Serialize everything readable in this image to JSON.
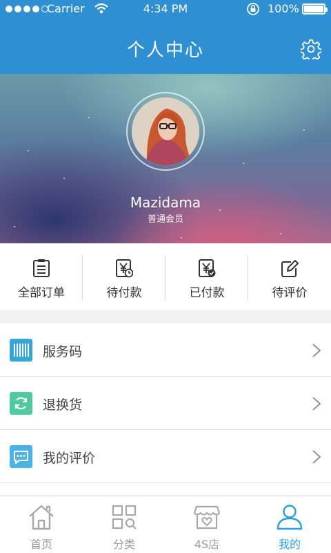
{
  "status_bar": {
    "carrier": "Carrier",
    "time": "4:34 PM",
    "battery": "100%"
  },
  "header": {
    "title": "个人中心",
    "settings_icon": "gear-icon"
  },
  "profile": {
    "username": "Mazidama",
    "member_level": "普通会员"
  },
  "orders": [
    {
      "label": "全部订单",
      "icon": "clipboard-icon"
    },
    {
      "label": "待付款",
      "icon": "yen-clock-icon"
    },
    {
      "label": "已付款",
      "icon": "yen-check-icon"
    },
    {
      "label": "待评价",
      "icon": "edit-icon"
    }
  ],
  "menu": [
    {
      "label": "服务码",
      "icon": "barcode-icon",
      "color": "#35a7d6"
    },
    {
      "label": "退换货",
      "icon": "exchange-icon",
      "color": "#4fcaa0"
    },
    {
      "label": "我的评价",
      "icon": "comment-icon",
      "color": "#4bb4e6"
    }
  ],
  "tabs": [
    {
      "label": "首页",
      "icon": "home-icon",
      "active": false
    },
    {
      "label": "分类",
      "icon": "category-icon",
      "active": false
    },
    {
      "label": "4S店",
      "icon": "store-icon",
      "active": false
    },
    {
      "label": "我的",
      "icon": "user-icon",
      "active": true
    }
  ],
  "colors": {
    "header": "#2e8fd3",
    "tab_active": "#2b9ee0",
    "tab_inactive": "#9a9a9a"
  }
}
